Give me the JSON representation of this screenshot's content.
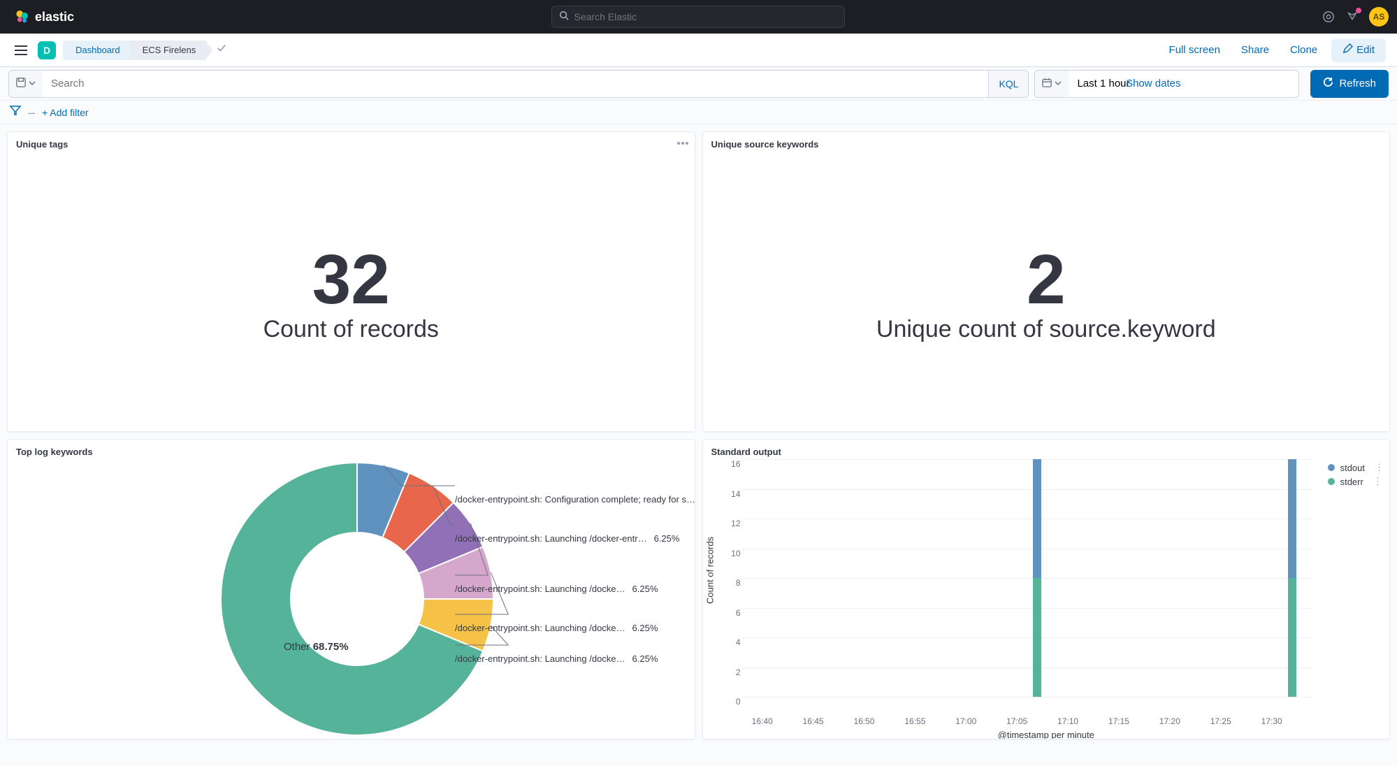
{
  "header": {
    "brand": "elastic",
    "search_placeholder": "Search Elastic",
    "avatar_initials": "AS"
  },
  "subheader": {
    "space_initial": "D",
    "crumb_dashboard": "Dashboard",
    "crumb_current": "ECS Firelens",
    "full_screen": "Full screen",
    "share": "Share",
    "clone": "Clone",
    "edit": "Edit"
  },
  "querybar": {
    "search_placeholder": "Search",
    "kql": "KQL",
    "time_value": "Last 1 hour",
    "show_dates": "Show dates",
    "refresh": "Refresh"
  },
  "filterbar": {
    "add_filter": "+ Add filter"
  },
  "panels": {
    "unique_tags_title": "Unique tags",
    "unique_source_title": "Unique source keywords",
    "top_keywords_title": "Top log keywords",
    "standard_output_title": "Standard output"
  },
  "metrics": {
    "records_value": "32",
    "records_label": "Count of records",
    "unique_source_value": "2",
    "unique_source_label": "Unique count of source.keyword"
  },
  "chart_data": [
    {
      "id": "top_log_keywords",
      "type": "pie",
      "title": "Top log keywords",
      "slices": [
        {
          "label": "Other",
          "pct": 68.75,
          "color": "#54b399"
        },
        {
          "label": "/docker-entrypoint.sh: Configuration complete; ready for s…",
          "pct": 6.25,
          "color": "#6092c0"
        },
        {
          "label": "/docker-entrypoint.sh: Launching /docker-entr…",
          "pct": 6.25,
          "color": "#e7664c"
        },
        {
          "label": "/docker-entrypoint.sh: Launching /docke…",
          "pct": 6.25,
          "color": "#9170b8"
        },
        {
          "label": "/docker-entrypoint.sh: Launching /docke…",
          "pct": 6.25,
          "color": "#d6a7cc"
        },
        {
          "label": "/docker-entrypoint.sh: Launching /docke…",
          "pct": 6.25,
          "color": "#f5c146"
        }
      ],
      "other_label_prefix": "Other",
      "other_pct_text": "68.75%"
    },
    {
      "id": "standard_output",
      "type": "bar",
      "title": "Standard output",
      "xlabel": "@timestamp per minute",
      "ylabel": "Count of records",
      "ylim": [
        0,
        16
      ],
      "yticks": [
        0,
        2,
        4,
        6,
        8,
        10,
        12,
        14,
        16
      ],
      "xticks": [
        "16:40",
        "16:45",
        "16:50",
        "16:55",
        "17:00",
        "17:05",
        "17:10",
        "17:15",
        "17:20",
        "17:25",
        "17:30"
      ],
      "series": [
        {
          "name": "stdout",
          "color": "#6092c0"
        },
        {
          "name": "stderr",
          "color": "#54b399"
        }
      ],
      "bars": [
        {
          "x": "17:07",
          "stdout": 8,
          "stderr": 8
        },
        {
          "x": "17:32",
          "stdout": 8,
          "stderr": 8
        }
      ]
    }
  ]
}
